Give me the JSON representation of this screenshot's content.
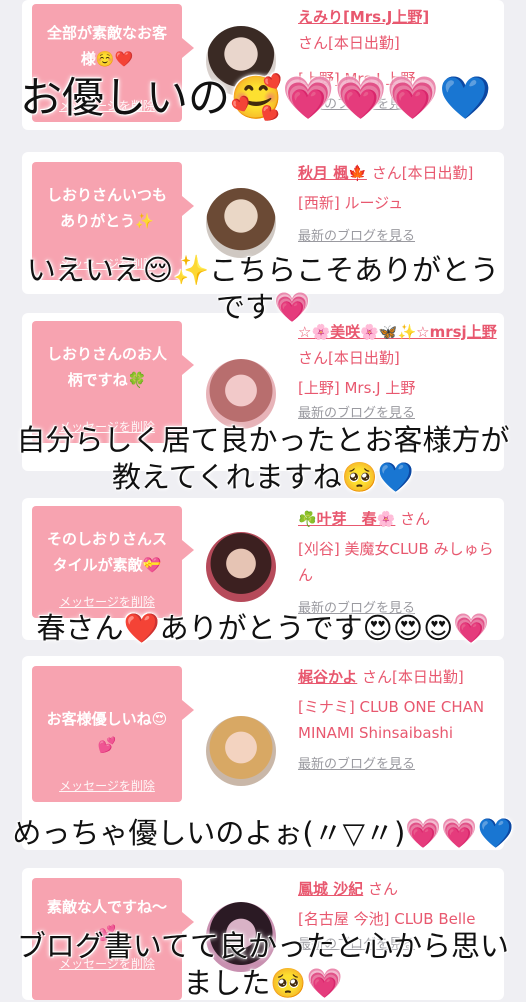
{
  "cards": [
    {
      "message": "全部が素敵なお客様☺️❤️",
      "delete_label": "メッセージを削除",
      "name": "えみり[Mrs.J上野]",
      "suffix": "さん[本日出勤]",
      "shop": "[上野] Mrs.J 上野",
      "blog": "最新のブログを見る"
    },
    {
      "message": "しおりさんいつもありがとう✨",
      "delete_label": "メッセージを削除",
      "name": "秋月 楓🍁",
      "suffix": "さん[本日出勤]",
      "shop": "[西新] ルージュ",
      "blog": "最新のブログを見る"
    },
    {
      "message": "しおりさんのお人柄ですね🍀",
      "delete_label": "メッセージを削除",
      "name": "☆🌸美咲🌸🦋✨☆mrsj上野",
      "suffix": "さん[本日出勤]",
      "shop": "[上野] Mrs.J 上野",
      "blog": "最新のブログを見る"
    },
    {
      "message": "そのしおりさんスタイルが素敵💝",
      "delete_label": "メッセージを削除",
      "name": "☘️叶芽　春🌸",
      "suffix": "さん",
      "shop": "[刈谷] 美魔女CLUB みしゅらん",
      "blog": "最新のブログを見る"
    },
    {
      "message": "お客様優しいね😍💕",
      "delete_label": "メッセージを削除",
      "name": "梶谷かよ",
      "suffix": "さん[本日出勤]",
      "shop": "[ミナミ] CLUB ONE CHAN MINAMI Shinsaibashi",
      "blog": "最新のブログを見る"
    },
    {
      "message": "素敵な人ですね〜💕",
      "delete_label": "メッセージを削除",
      "name": "鳳城 沙紀",
      "suffix": "さん",
      "shop": "[名古屋 今池] CLUB Belle",
      "blog": "最新のブログを見る"
    }
  ],
  "overlays": {
    "o1": "お優しいの🥰💗💗💗💙",
    "o2a": "いえいえ😌✨こちらこそありがとう",
    "o2b": "です💗",
    "o3a": "自分らしく居て良かったとお客様方が",
    "o3b": "教えてくれますね🥺💙",
    "o4": "春さん❤️ありがとうです😍😍😍💗",
    "o5": "めっちゃ優しいのよぉ(〃▽〃)💗💗💙",
    "o6a": "ブログ書いてて良かったと心から思い",
    "o6b": "ました🥺💗"
  },
  "colors": {
    "bubble": "#f7a3b0",
    "name": "#e8586f",
    "background": "#efeff3"
  }
}
